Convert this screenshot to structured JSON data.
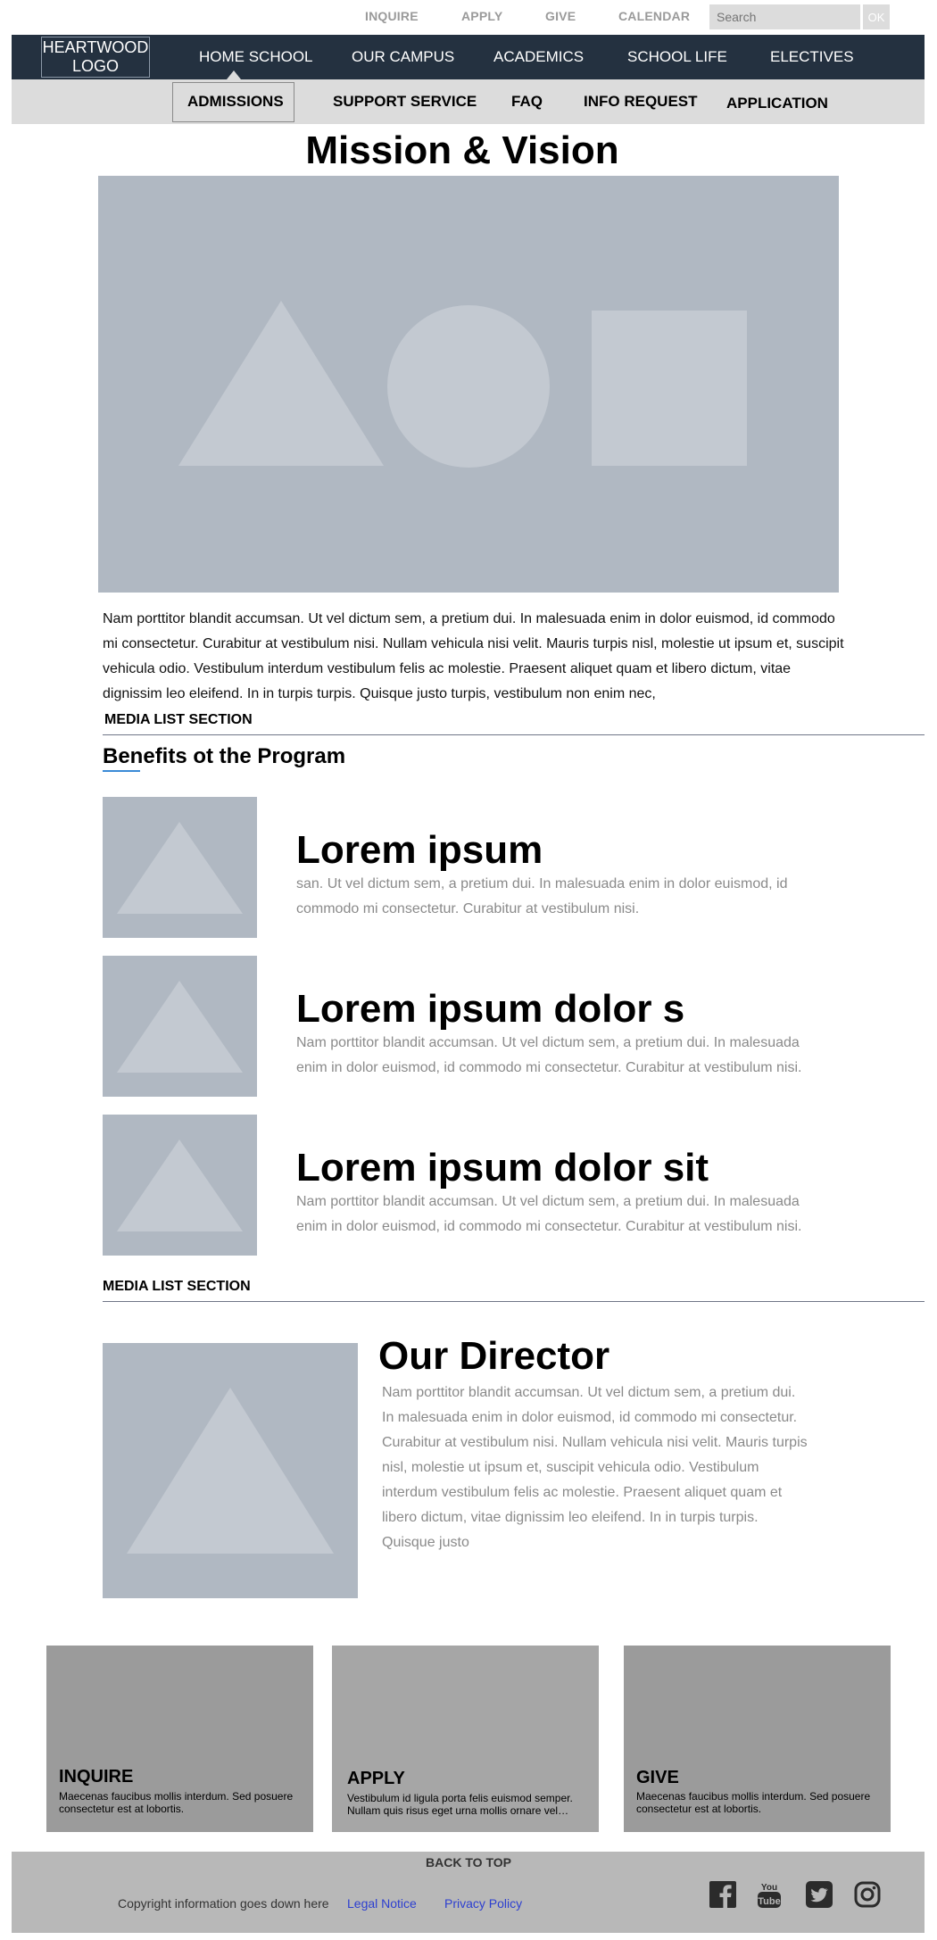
{
  "utility_nav": {
    "links": [
      "INQUIRE",
      "APPLY",
      "GIVE",
      "CALENDAR"
    ],
    "search_placeholder": "Search",
    "search_button": "OK"
  },
  "main_nav": {
    "logo_line1": "HEARTWOOD",
    "logo_line2": "LOGO",
    "items": [
      "HOME SCHOOL",
      "OUR CAMPUS",
      "ACADEMICS",
      "SCHOOL LIFE",
      "ELECTIVES"
    ]
  },
  "sub_nav": {
    "items": [
      "ADMISSIONS",
      "SUPPORT SERVICE",
      "FAQ",
      "INFO REQUEST",
      "APPLICATION"
    ]
  },
  "page": {
    "title": "Mission & Vision",
    "body": "Nam porttitor blandit accumsan. Ut vel dictum sem, a pretium dui. In malesuada enim in dolor euismod, id commodo mi consectetur. Curabitur at vestibulum nisi. Nullam vehicula nisi velit. Mauris turpis nisl, molestie ut ipsum et, suscipit vehicula odio. Vestibulum interdum vestibulum felis ac molestie. Praesent aliquet quam et libero dictum, vitae dignissim leo eleifend. In in turpis turpis. Quisque justo turpis, vestibulum non enim nec,"
  },
  "benefits": {
    "section_label": "MEDIA LIST SECTION",
    "title": "Benefits ot the Program",
    "items": [
      {
        "heading": "Lorem ipsum",
        "text": "san. Ut vel dictum sem, a pretium dui. In malesuada enim in dolor euismod, id commodo mi consectetur. Curabitur at vestibulum nisi."
      },
      {
        "heading": "Lorem ipsum dolor s",
        "text": "Nam porttitor blandit accumsan. Ut vel dictum sem, a pretium dui. In malesuada enim in dolor euismod, id commodo mi consectetur. Curabitur at vestibulum nisi."
      },
      {
        "heading": "Lorem ipsum dolor sit",
        "text": "Nam porttitor blandit accumsan. Ut vel dictum sem, a pretium dui. In malesuada enim in dolor euismod, id commodo mi consectetur. Curabitur at vestibulum nisi."
      }
    ]
  },
  "director": {
    "section_label": "MEDIA LIST SECTION",
    "title": "Our Director",
    "text": "Nam porttitor blandit accumsan. Ut vel dictum sem, a pretium dui. In malesuada enim in dolor euismod, id commodo mi consectetur. Curabitur at vestibulum nisi. Nullam vehicula nisi velit. Mauris turpis nisl, molestie ut ipsum et, suscipit vehicula odio. Vestibulum interdum vestibulum felis ac molestie. Praesent aliquet quam et libero dictum, vitae dignissim leo eleifend. In in turpis turpis. Quisque justo"
  },
  "cta_cards": [
    {
      "title": "INQUIRE",
      "text": "Maecenas faucibus mollis interdum. Sed posuere consectetur est at lobortis."
    },
    {
      "title": "APPLY",
      "text": "Vestibulum id ligula porta felis euismod semper. Nullam quis risus eget urna mollis ornare vel…"
    },
    {
      "title": "GIVE",
      "text": "Maecenas faucibus mollis interdum. Sed posuere consectetur est at lobortis."
    }
  ],
  "footer": {
    "back_to_top": "BACK TO TOP",
    "copyright": "Copyright information goes down here",
    "legal": "Legal Notice",
    "privacy": "Privacy Policy",
    "social_icons": [
      "facebook-icon",
      "youtube-icon",
      "twitter-icon",
      "instagram-icon"
    ]
  },
  "colors": {
    "nav_bg": "#243140",
    "subnav_bg": "#dcdcdc",
    "placeholder_gray": "#b0b8c2",
    "placeholder_shape": "#c3c9d1",
    "footer_bg": "#b8b8b8",
    "link_blue": "#2d3fd0",
    "accent_underline": "#3a8ad6"
  }
}
